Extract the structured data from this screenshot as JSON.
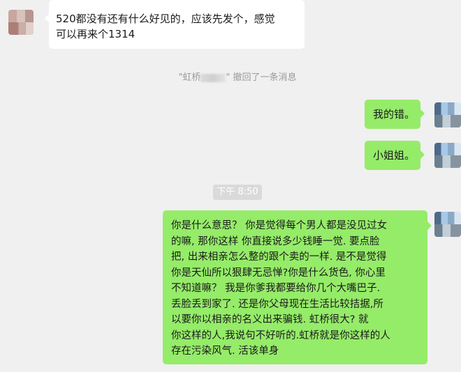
{
  "messages": [
    {
      "side": "left",
      "lines": [
        "520都没有还有什么好见的，应该先发个，感觉",
        "可以再来个1314"
      ]
    },
    {
      "side": "right",
      "text": "我的错。"
    },
    {
      "side": "right",
      "text": "小姐姐。"
    },
    {
      "side": "right",
      "lines": [
        "你是什么意思？  你是觉得每个男人都是没见过女",
        "的嘛, 那你这样  你直接说多少钱睡一觉. 要点脸",
        "把, 出来相亲怎么整的跟个卖的一样. 是不是觉得",
        "你是天仙所以狠肆无忌惮?你是什么货色, 你心里",
        "不知道嘛？ 我是你爹我都要给你几个大嘴巴子.",
        "丢脸丢到家了. 还是你父母现在生活比较拮据,所",
        "以要你以相亲的名义出来骗钱.   虹桥很大?   就",
        "你这样的人,我说句不好听的.虹桥就是你这样的人",
        "存在污染风气. 活该单身"
      ]
    }
  ],
  "recall_notice": {
    "prefix": "\"虹桥",
    "suffix": "\" 撤回了一条消息"
  },
  "timestamp": "下午 8:50",
  "colors": {
    "background": "#f0f0f0",
    "incoming_bubble": "#ffffff",
    "outgoing_bubble": "#95ec69"
  }
}
